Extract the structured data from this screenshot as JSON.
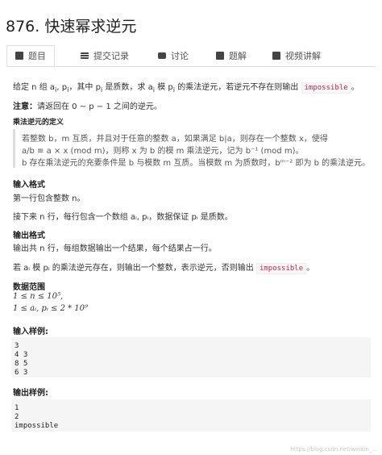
{
  "title": "876. 快速幂求逆元",
  "tabs": [
    {
      "label": "题目",
      "icon": "doc-icon"
    },
    {
      "label": "提交记录",
      "icon": "list-icon"
    },
    {
      "label": "讨论",
      "icon": "chat-icon"
    },
    {
      "label": "题解",
      "icon": "book-icon"
    },
    {
      "label": "视频讲解",
      "icon": "video-icon"
    }
  ],
  "problem": {
    "intro_a": "给定 n 组 a",
    "intro_b": "i",
    "intro_c": ", p",
    "intro_d": "，其中 p",
    "intro_e": " 是质数，求 a",
    "intro_f": " 模 p",
    "intro_g": " 的乘法逆元，若逆元不存在则输出",
    "intro_code": "impossible",
    "intro_end": "。",
    "note_label": "注意：",
    "note_text": "请返回在 0 ∼ p − 1 之间的逆元。",
    "def_title": "乘法逆元的定义",
    "def_line1": "若整数 b，m 互质，并且对于任意的整数 a，如果满足 b|a，则存在一个整数 x，使得",
    "def_line2": "a/b ≡ a × x (mod m)，则称 x 为 b 的模 m 乘法逆元，记为 b⁻¹ (mod m)。",
    "def_line3": "b 存在乘法逆元的充要条件是 b 与模数 m 互质。当模数 m 为质数时，bᵐ⁻² 即为 b 的乘法逆元。",
    "input_title": "输入格式",
    "input_line1": "第一行包含整数 n。",
    "input_line2": "接下来 n 行，每行包含一个数组 aᵢ, pᵢ，数据保证 pᵢ 是质数。",
    "output_title": "输出格式",
    "output_line1": "输出共 n 行，每组数据输出一个结果，每个结果占一行。",
    "output_line2": "若 aᵢ 模 pᵢ 的乘法逆元存在，则输出一个整数，表示逆元，否则输出",
    "output_code": "impossible",
    "output_end": "。",
    "range_title": "数据范围",
    "range_line1": "1 ≤ n ≤ 10⁵,",
    "range_line2": "1 ≤ aᵢ, pᵢ ≤ 2 * 10⁹",
    "sample_in_title": "输入样例:",
    "sample_in": [
      "3",
      "4 3",
      "8 5",
      "6 3"
    ],
    "sample_out_title": "输出样例:",
    "sample_out": [
      "1",
      "2",
      "impossible"
    ]
  },
  "watermark": "https://blog.csdn.net/weixin_..."
}
